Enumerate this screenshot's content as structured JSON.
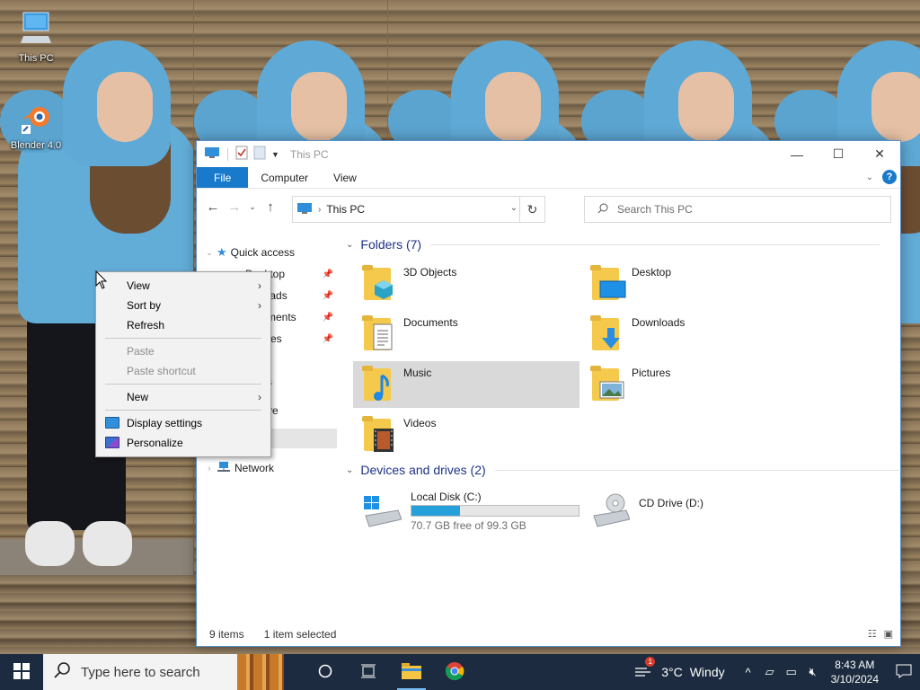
{
  "desktop": {
    "icons": [
      {
        "label": "This PC",
        "icon": "this-pc-icon"
      },
      {
        "label": "Blender 4.0",
        "icon": "blender-icon"
      }
    ]
  },
  "explorer": {
    "title": "This PC",
    "ribbon_tabs": [
      "File",
      "Computer",
      "View"
    ],
    "help_label": "?",
    "address": {
      "crumb": "This PC"
    },
    "search": {
      "placeholder": "Search This PC"
    },
    "nav_pane": {
      "quick_access": "Quick access",
      "partial_items": [
        "Desktop",
        "loads",
        "ments",
        "res",
        "",
        "s",
        "ve",
        ""
      ],
      "network": "Network"
    },
    "groups": {
      "folders_header": "Folders (7)",
      "devices_header": "Devices and drives (2)"
    },
    "folders": [
      {
        "name": "3D Objects",
        "icon": "3d-objects-icon"
      },
      {
        "name": "Desktop",
        "icon": "desktop-folder-icon"
      },
      {
        "name": "Documents",
        "icon": "documents-icon"
      },
      {
        "name": "Downloads",
        "icon": "downloads-icon"
      },
      {
        "name": "Music",
        "icon": "music-icon",
        "selected": true
      },
      {
        "name": "Pictures",
        "icon": "pictures-icon"
      },
      {
        "name": "Videos",
        "icon": "videos-icon"
      }
    ],
    "drives": [
      {
        "name": "Local Disk (C:)",
        "free_text": "70.7 GB free of 99.3 GB",
        "used_fraction": 0.288
      },
      {
        "name": "CD Drive (D:)"
      }
    ],
    "status": {
      "items": "9 items",
      "selected": "1 item selected"
    }
  },
  "context_menu": {
    "items": [
      {
        "label": "View",
        "submenu": true,
        "enabled": true
      },
      {
        "label": "Sort by",
        "submenu": true,
        "enabled": true
      },
      {
        "label": "Refresh",
        "enabled": true
      },
      {
        "label": "Paste",
        "enabled": false
      },
      {
        "label": "Paste shortcut",
        "enabled": false
      },
      {
        "label": "New",
        "submenu": true,
        "enabled": true
      },
      {
        "label": "Display settings",
        "enabled": true,
        "icon": "display-settings-icon"
      },
      {
        "label": "Personalize",
        "enabled": true,
        "icon": "personalize-icon"
      }
    ]
  },
  "taskbar": {
    "search_placeholder": "Type here to search",
    "weather": {
      "temp": "3°C",
      "condition": "Windy",
      "badge": "1"
    },
    "clock": {
      "time": "8:43 AM",
      "date": "3/10/2024"
    }
  }
}
